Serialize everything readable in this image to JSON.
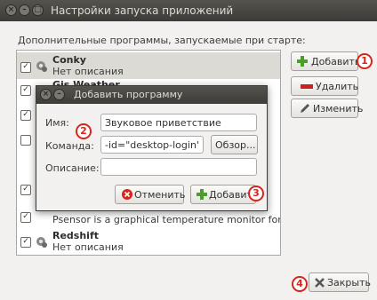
{
  "window": {
    "title": "Настройки запуска приложений",
    "close_glyph": "×",
    "minimize_glyph": "–",
    "maximize_glyph": "□"
  },
  "hint": "Дополнительные программы, запускаемые при старте:",
  "list": {
    "items": [
      {
        "name": "Conky",
        "description": "Нет описания",
        "checked": true,
        "selected": true
      },
      {
        "name": "Gis Weather",
        "description": "",
        "checked": true,
        "selected": false
      },
      {
        "name": "",
        "description": "",
        "checked": true,
        "selected": false
      },
      {
        "name": "",
        "description": "",
        "checked": false,
        "selected": false
      },
      {
        "name": "",
        "description": "",
        "checked": true,
        "selected": false
      },
      {
        "name": "",
        "description": "",
        "checked": true,
        "selected": false
      },
      {
        "name": "",
        "description": "Psensor is a graphical temperature monitor for Linux",
        "checked": true,
        "selected": false
      },
      {
        "name": "Redshift",
        "description": "Нет описания",
        "checked": true,
        "selected": false
      }
    ]
  },
  "side_buttons": {
    "add": "Добавить",
    "remove": "Удалить",
    "edit": "Изменить"
  },
  "dialog": {
    "title": "Добавить программу",
    "name_label": "Имя:",
    "name_value": "Звуковое приветствие",
    "command_label": "Команда:",
    "command_value": "-id=\"desktop-login\" --d",
    "browse_button": "Обзор...",
    "comment_label": "Описание:",
    "comment_value": "",
    "cancel_button": "Отменить",
    "add_button": "Добавить"
  },
  "close_button": "Закрыть",
  "badges": {
    "b1": "1",
    "b2": "2",
    "b3": "3",
    "b4": "4"
  },
  "colors": {
    "badge": "#d9241b",
    "add_icon": "#4a9e2a",
    "remove_icon": "#cc1f1f",
    "cancel_icon": "#d9241b"
  }
}
